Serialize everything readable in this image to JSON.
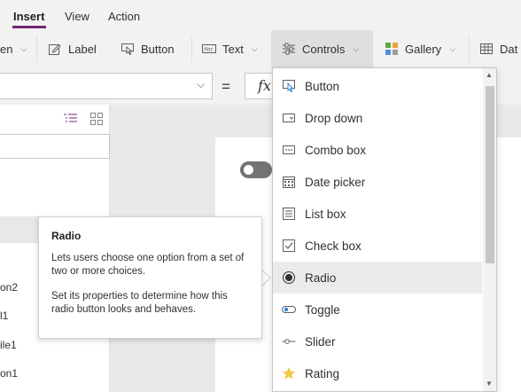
{
  "menubar": {
    "tabs": [
      {
        "label": "Insert",
        "active": true
      },
      {
        "label": "View"
      },
      {
        "label": "Action"
      }
    ]
  },
  "ribbon": {
    "items": [
      {
        "label": "en",
        "icon": "new-screen-icon"
      },
      {
        "label": "Label",
        "icon": "label-edit-icon"
      },
      {
        "label": "Button",
        "icon": "button-touch-icon"
      },
      {
        "label": "Text",
        "icon": "text-abc-icon"
      },
      {
        "label": "Controls",
        "icon": "sliders-icon",
        "selected": true
      },
      {
        "label": "Gallery",
        "icon": "gallery-grid-icon"
      },
      {
        "label": "Dat",
        "icon": "data-table-icon"
      }
    ]
  },
  "formula": {
    "equals": "=",
    "fx": "fx"
  },
  "tree": {
    "items": [
      "on2",
      "l1",
      "ile1",
      "on1"
    ]
  },
  "tooltip": {
    "title": "Radio",
    "desc1": "Lets users choose one option from a set of two or more choices.",
    "desc2": "Set its properties to determine how this radio button looks and behaves."
  },
  "controls_menu": {
    "items": [
      {
        "label": "Button",
        "icon": "button-touch-icon"
      },
      {
        "label": "Drop down",
        "icon": "dropdown-icon"
      },
      {
        "label": "Combo box",
        "icon": "combo-box-icon"
      },
      {
        "label": "Date picker",
        "icon": "calendar-icon"
      },
      {
        "label": "List box",
        "icon": "list-box-icon"
      },
      {
        "label": "Check box",
        "icon": "checkbox-icon"
      },
      {
        "label": "Radio",
        "icon": "radio-icon",
        "hovered": true
      },
      {
        "label": "Toggle",
        "icon": "toggle-icon"
      },
      {
        "label": "Slider",
        "icon": "slider-icon"
      },
      {
        "label": "Rating",
        "icon": "star-icon"
      }
    ]
  },
  "colors": {
    "accent": "#742774",
    "star": "#f2c94c",
    "toggle": "#737373"
  }
}
